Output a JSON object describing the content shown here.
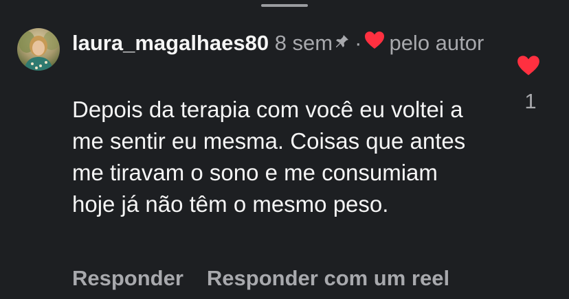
{
  "comment": {
    "username": "laura_magalhaes80",
    "time": "8 sem",
    "liked_by_author_label": "pelo autor",
    "text": "Depois da terapia com você eu voltei a me sentir eu mesma. Coisas que antes me tiravam o sono e me consumiam hoje já não têm o mesmo peso.",
    "like_count": "1"
  },
  "actions": {
    "reply_label": "Responder",
    "reply_reel_label": "Responder com um reel"
  },
  "icons": {
    "pin": "pin-icon",
    "heart": "heart-icon"
  },
  "colors": {
    "background": "#1d1f22",
    "heart_red": "#ff3040",
    "muted_text": "#a8a9ad",
    "primary_text": "#f5f5f5"
  }
}
